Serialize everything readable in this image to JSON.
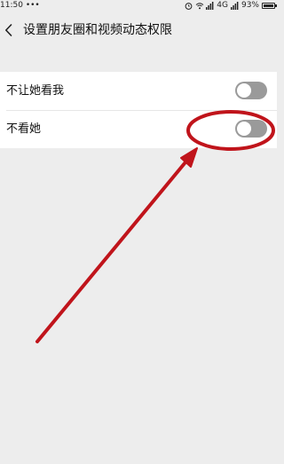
{
  "status_bar": {
    "time": "11:50",
    "dots": "•••",
    "network": "4G",
    "battery": "93%",
    "icons": [
      "alarm-icon",
      "wifi-icon",
      "signal-icon",
      "signal-icon",
      "battery-icon"
    ]
  },
  "header": {
    "title": "设置朋友圈和视频动态权限",
    "back_icon": "chevron-left-icon"
  },
  "settings": {
    "items": [
      {
        "label": "不让她看我",
        "enabled": false
      },
      {
        "label": "不看她",
        "enabled": false
      }
    ]
  },
  "colors": {
    "background": "#ededed",
    "row_background": "#ffffff",
    "toggle_off": "#9a9a9a",
    "annotation": "#c0141b"
  }
}
